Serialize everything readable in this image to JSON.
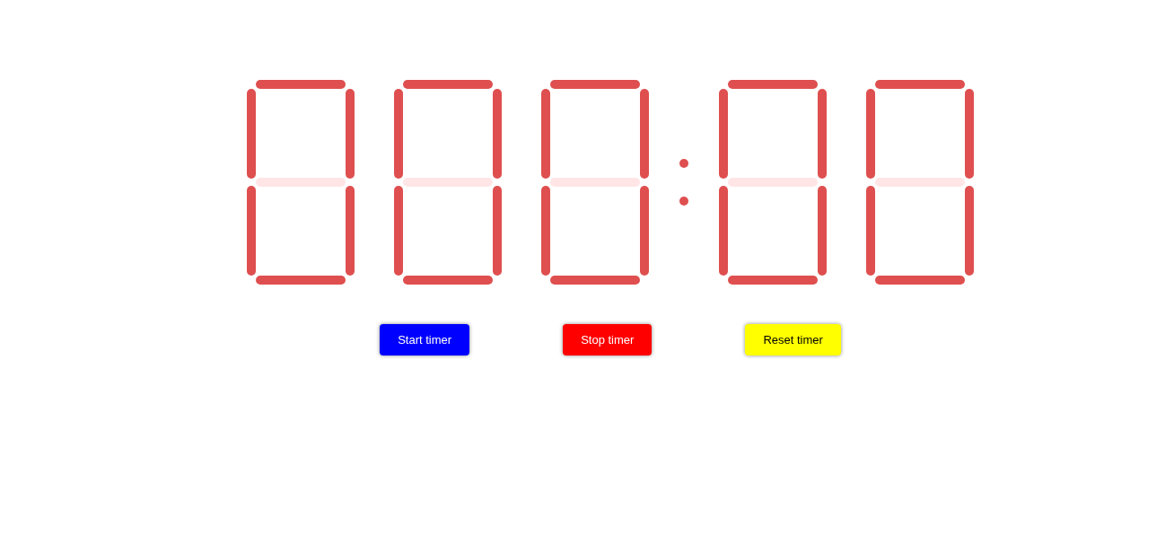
{
  "display": {
    "groups": [
      {
        "digits": [
          {
            "segments": [
              {
                "kind": "top",
                "on": true
              },
              {
                "kind": "upper_left",
                "on": true
              },
              {
                "kind": "upper_right",
                "on": true
              },
              {
                "kind": "middle",
                "on": false
              },
              {
                "kind": "lower_left",
                "on": true
              },
              {
                "kind": "lower_right",
                "on": true
              },
              {
                "kind": "bottom",
                "on": true
              }
            ]
          },
          {
            "segments": [
              {
                "kind": "top",
                "on": true
              },
              {
                "kind": "upper_left",
                "on": true
              },
              {
                "kind": "upper_right",
                "on": true
              },
              {
                "kind": "middle",
                "on": false
              },
              {
                "kind": "lower_left",
                "on": true
              },
              {
                "kind": "lower_right",
                "on": true
              },
              {
                "kind": "bottom",
                "on": true
              }
            ]
          },
          {
            "segments": [
              {
                "kind": "top",
                "on": true
              },
              {
                "kind": "upper_left",
                "on": true
              },
              {
                "kind": "upper_right",
                "on": true
              },
              {
                "kind": "middle",
                "on": false
              },
              {
                "kind": "lower_left",
                "on": true
              },
              {
                "kind": "lower_right",
                "on": true
              },
              {
                "kind": "bottom",
                "on": true
              }
            ]
          }
        ]
      },
      {
        "digits": [
          {
            "segments": [
              {
                "kind": "top",
                "on": true
              },
              {
                "kind": "upper_left",
                "on": true
              },
              {
                "kind": "upper_right",
                "on": true
              },
              {
                "kind": "middle",
                "on": false
              },
              {
                "kind": "lower_left",
                "on": true
              },
              {
                "kind": "lower_right",
                "on": true
              },
              {
                "kind": "bottom",
                "on": true
              }
            ]
          },
          {
            "segments": [
              {
                "kind": "top",
                "on": true
              },
              {
                "kind": "upper_left",
                "on": true
              },
              {
                "kind": "upper_right",
                "on": true
              },
              {
                "kind": "middle",
                "on": false
              },
              {
                "kind": "lower_left",
                "on": true
              },
              {
                "kind": "lower_right",
                "on": true
              },
              {
                "kind": "bottom",
                "on": true
              }
            ]
          }
        ]
      }
    ]
  },
  "buttons": [
    {
      "label": "Start timer",
      "color": "#0000ff"
    },
    {
      "label": "Stop timer",
      "color": "#ff0000"
    },
    {
      "label": "Reset timer",
      "color": "#ffff00"
    }
  ]
}
